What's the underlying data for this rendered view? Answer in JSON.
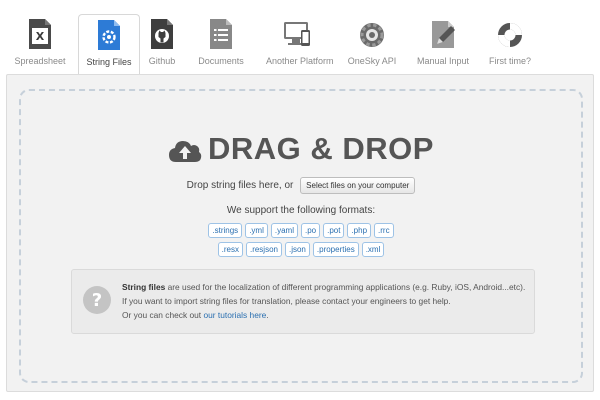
{
  "tabs": [
    {
      "label": "Spreadsheet",
      "icon": "spreadsheet-icon",
      "active": false
    },
    {
      "label": "String Files",
      "icon": "string-files-icon",
      "active": true
    },
    {
      "label": "Github",
      "icon": "github-icon",
      "active": false
    },
    {
      "label": "Documents",
      "icon": "documents-icon",
      "active": false
    },
    {
      "label": "Another Platform",
      "icon": "another-platform-icon",
      "active": false
    },
    {
      "label": "OneSky API",
      "icon": "gear-icon",
      "active": false
    },
    {
      "label": "Manual Input",
      "icon": "pencil-icon",
      "active": false
    },
    {
      "label": "First time?",
      "icon": "lifebuoy-icon",
      "active": false
    }
  ],
  "dropzone": {
    "title": "DRAG & DROP",
    "drop_text": "Drop string files here, or",
    "select_button": "Select files on your computer",
    "support_text": "We support the following formats:",
    "formats_row1": [
      ".strings",
      ".yml",
      ".yaml",
      ".po",
      ".pot",
      ".php",
      ".rrc"
    ],
    "formats_row2": [
      ".resx",
      ".resjson",
      ".json",
      ".properties",
      ".xml"
    ]
  },
  "info": {
    "bold": "String files",
    "line1_rest": " are used for the localization of different programming applications (e.g. Ruby, iOS, Android...etc).",
    "line2": "If you want to import string files for translation, please contact your engineers to get help.",
    "line3_prefix": "Or you can check out ",
    "link": "our tutorials here",
    "line3_suffix": "."
  },
  "colors": {
    "accent": "#2a6fb0",
    "active_tab_icon": "#2d7bd6",
    "panel_bg": "#f2f2f2",
    "dashed_border": "#c6d0da"
  }
}
